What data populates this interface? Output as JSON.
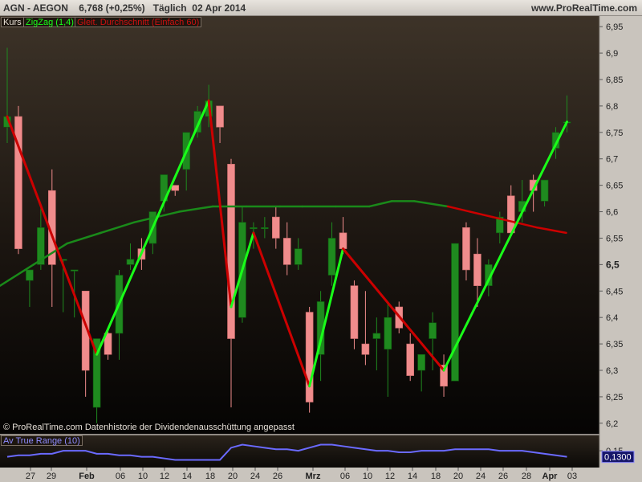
{
  "header": {
    "title": "AGN - AEGON    6,768 (+0,25%)   Täglich  02 Apr 2014",
    "site": "www.ProRealTime.com"
  },
  "legend": {
    "kurs": "Kurs",
    "zigzag": "ZigZag (1,4)",
    "ma": "Gleit. Durchschnitt (Einfach 60)"
  },
  "footer": {
    "copyright": "© ProRealTime.com  Datenhistorie der Dividendenausschüttung angepasst"
  },
  "atr": {
    "label": "Av True Range (10)",
    "value_label": "0,1300",
    "tick_label": "0,15"
  },
  "colors": {
    "background": "#000000",
    "up_candle": "#1f8a1f",
    "down_candle": "#f08c8c",
    "zigzag_up": "#19ff19",
    "zigzag_down": "#cc0000",
    "ma_line": "#1a8a1a",
    "atr_line": "#6a6aff"
  },
  "chart_data": {
    "type": "candlestick",
    "title": "AGN - AEGON",
    "ylim": [
      6.18,
      6.97
    ],
    "yticks": [
      "6,2",
      "6,25",
      "6,3",
      "6,35",
      "6,4",
      "6,45",
      "6,5",
      "6,55",
      "6,6",
      "6,65",
      "6,7",
      "6,75",
      "6,8",
      "6,85",
      "6,9",
      "6,95"
    ],
    "xticks": [
      "27",
      "29",
      "Feb",
      "06",
      "10",
      "12",
      "14",
      "18",
      "20",
      "24",
      "26",
      "Mrz",
      "06",
      "10",
      "12",
      "14",
      "18",
      "20",
      "24",
      "26",
      "28",
      "Apr",
      "03"
    ],
    "candles": [
      {
        "o": 6.76,
        "h": 6.91,
        "l": 6.73,
        "c": 6.78
      },
      {
        "o": 6.78,
        "h": 6.8,
        "l": 6.52,
        "c": 6.53
      },
      {
        "o": 6.47,
        "h": 6.49,
        "l": 6.42,
        "c": 6.49
      },
      {
        "o": 6.5,
        "h": 6.61,
        "l": 6.49,
        "c": 6.57
      },
      {
        "o": 6.64,
        "h": 6.68,
        "l": 6.42,
        "c": 6.5
      },
      {
        "o": 6.51,
        "h": 6.51,
        "l": 6.41,
        "c": 6.51
      },
      {
        "o": 6.49,
        "h": 6.49,
        "l": 6.4,
        "c": 6.49
      },
      {
        "o": 6.45,
        "h": 6.45,
        "l": 6.25,
        "c": 6.3
      },
      {
        "o": 6.23,
        "h": 6.36,
        "l": 6.2,
        "c": 6.36
      },
      {
        "o": 6.37,
        "h": 6.38,
        "l": 6.32,
        "c": 6.33
      },
      {
        "o": 6.37,
        "h": 6.49,
        "l": 6.32,
        "c": 6.48
      },
      {
        "o": 6.5,
        "h": 6.54,
        "l": 6.49,
        "c": 6.51
      },
      {
        "o": 6.53,
        "h": 6.55,
        "l": 6.49,
        "c": 6.51
      },
      {
        "o": 6.54,
        "h": 6.6,
        "l": 6.52,
        "c": 6.6
      },
      {
        "o": 6.62,
        "h": 6.67,
        "l": 6.6,
        "c": 6.67
      },
      {
        "o": 6.65,
        "h": 6.65,
        "l": 6.63,
        "c": 6.64
      },
      {
        "o": 6.68,
        "h": 6.75,
        "l": 6.64,
        "c": 6.75
      },
      {
        "o": 6.75,
        "h": 6.8,
        "l": 6.74,
        "c": 6.79
      },
      {
        "o": 6.78,
        "h": 6.84,
        "l": 6.76,
        "c": 6.81
      },
      {
        "o": 6.8,
        "h": 6.8,
        "l": 6.73,
        "c": 6.76
      },
      {
        "o": 6.69,
        "h": 6.7,
        "l": 6.23,
        "c": 6.36
      },
      {
        "o": 6.4,
        "h": 6.61,
        "l": 6.39,
        "c": 6.58
      },
      {
        "o": 6.57,
        "h": 6.58,
        "l": 6.53,
        "c": 6.57
      },
      {
        "o": 6.57,
        "h": 6.59,
        "l": 6.55,
        "c": 6.57
      },
      {
        "o": 6.59,
        "h": 6.61,
        "l": 6.53,
        "c": 6.55
      },
      {
        "o": 6.55,
        "h": 6.58,
        "l": 6.48,
        "c": 6.5
      },
      {
        "o": 6.5,
        "h": 6.55,
        "l": 6.49,
        "c": 6.53
      },
      {
        "o": 6.41,
        "h": 6.42,
        "l": 6.22,
        "c": 6.24
      },
      {
        "o": 6.33,
        "h": 6.45,
        "l": 6.28,
        "c": 6.43
      },
      {
        "o": 6.48,
        "h": 6.58,
        "l": 6.46,
        "c": 6.55
      },
      {
        "o": 6.56,
        "h": 6.59,
        "l": 6.52,
        "c": 6.53
      },
      {
        "o": 6.46,
        "h": 6.47,
        "l": 6.34,
        "c": 6.36
      },
      {
        "o": 6.35,
        "h": 6.45,
        "l": 6.31,
        "c": 6.33
      },
      {
        "o": 6.36,
        "h": 6.4,
        "l": 6.3,
        "c": 6.37
      },
      {
        "o": 6.34,
        "h": 6.43,
        "l": 6.25,
        "c": 6.4
      },
      {
        "o": 6.42,
        "h": 6.43,
        "l": 6.37,
        "c": 6.38
      },
      {
        "o": 6.35,
        "h": 6.37,
        "l": 6.28,
        "c": 6.29
      },
      {
        "o": 6.3,
        "h": 6.33,
        "l": 6.26,
        "c": 6.33
      },
      {
        "o": 6.36,
        "h": 6.41,
        "l": 6.3,
        "c": 6.39
      },
      {
        "o": 6.31,
        "h": 6.33,
        "l": 6.25,
        "c": 6.27
      },
      {
        "o": 6.28,
        "h": 6.54,
        "l": 6.28,
        "c": 6.54
      },
      {
        "o": 6.57,
        "h": 6.58,
        "l": 6.47,
        "c": 6.49
      },
      {
        "o": 6.52,
        "h": 6.55,
        "l": 6.42,
        "c": 6.46
      },
      {
        "o": 6.46,
        "h": 6.51,
        "l": 6.44,
        "c": 6.5
      },
      {
        "o": 6.56,
        "h": 6.6,
        "l": 6.54,
        "c": 6.59
      },
      {
        "o": 6.63,
        "h": 6.65,
        "l": 6.56,
        "c": 6.56
      },
      {
        "o": 6.6,
        "h": 6.66,
        "l": 6.58,
        "c": 6.62
      },
      {
        "o": 6.66,
        "h": 6.67,
        "l": 6.6,
        "c": 6.64
      },
      {
        "o": 6.62,
        "h": 6.62,
        "l": 6.61,
        "c": 6.66
      },
      {
        "o": 6.72,
        "h": 6.76,
        "l": 6.7,
        "c": 6.75
      },
      {
        "o": 6.77,
        "h": 6.82,
        "l": 6.75,
        "c": 6.77
      }
    ],
    "zigzag": [
      {
        "i": 0,
        "v": 6.78
      },
      {
        "i": 8,
        "v": 6.33
      },
      {
        "i": 18,
        "v": 6.81
      },
      {
        "i": 20,
        "v": 6.42
      },
      {
        "i": 22,
        "v": 6.56
      },
      {
        "i": 27,
        "v": 6.27
      },
      {
        "i": 30,
        "v": 6.53
      },
      {
        "i": 39,
        "v": 6.3
      },
      {
        "i": 50,
        "v": 6.77
      }
    ],
    "moving_average": [
      {
        "i": 0,
        "v": 6.46
      },
      {
        "i": 3,
        "v": 6.5
      },
      {
        "i": 6,
        "v": 6.54
      },
      {
        "i": 9,
        "v": 6.56
      },
      {
        "i": 12,
        "v": 6.58
      },
      {
        "i": 16,
        "v": 6.6
      },
      {
        "i": 19,
        "v": 6.61
      },
      {
        "i": 22,
        "v": 6.61
      },
      {
        "i": 25,
        "v": 6.61
      },
      {
        "i": 27,
        "v": 6.61
      },
      {
        "i": 30,
        "v": 6.61
      },
      {
        "i": 33,
        "v": 6.61
      },
      {
        "i": 35,
        "v": 6.62
      },
      {
        "i": 37,
        "v": 6.62
      },
      {
        "i": 40,
        "v": 6.61
      },
      {
        "i": 42,
        "v": 6.6
      },
      {
        "i": 44,
        "v": 6.59
      },
      {
        "i": 46,
        "v": 6.58
      },
      {
        "i": 48,
        "v": 6.57
      },
      {
        "i": 50,
        "v": 6.56
      }
    ],
    "atr": {
      "name": "Av True Range (10)",
      "ylim": [
        0.1,
        0.19
      ],
      "last": 0.13,
      "values": [
        0.13,
        0.135,
        0.135,
        0.14,
        0.14,
        0.15,
        0.15,
        0.15,
        0.14,
        0.14,
        0.135,
        0.135,
        0.13,
        0.13,
        0.125,
        0.12,
        0.12,
        0.12,
        0.12,
        0.12,
        0.16,
        0.17,
        0.165,
        0.16,
        0.155,
        0.155,
        0.15,
        0.16,
        0.17,
        0.17,
        0.165,
        0.16,
        0.155,
        0.15,
        0.15,
        0.145,
        0.145,
        0.15,
        0.15,
        0.15,
        0.155,
        0.155,
        0.155,
        0.155,
        0.15,
        0.15,
        0.15,
        0.145,
        0.14,
        0.135,
        0.13
      ]
    }
  }
}
